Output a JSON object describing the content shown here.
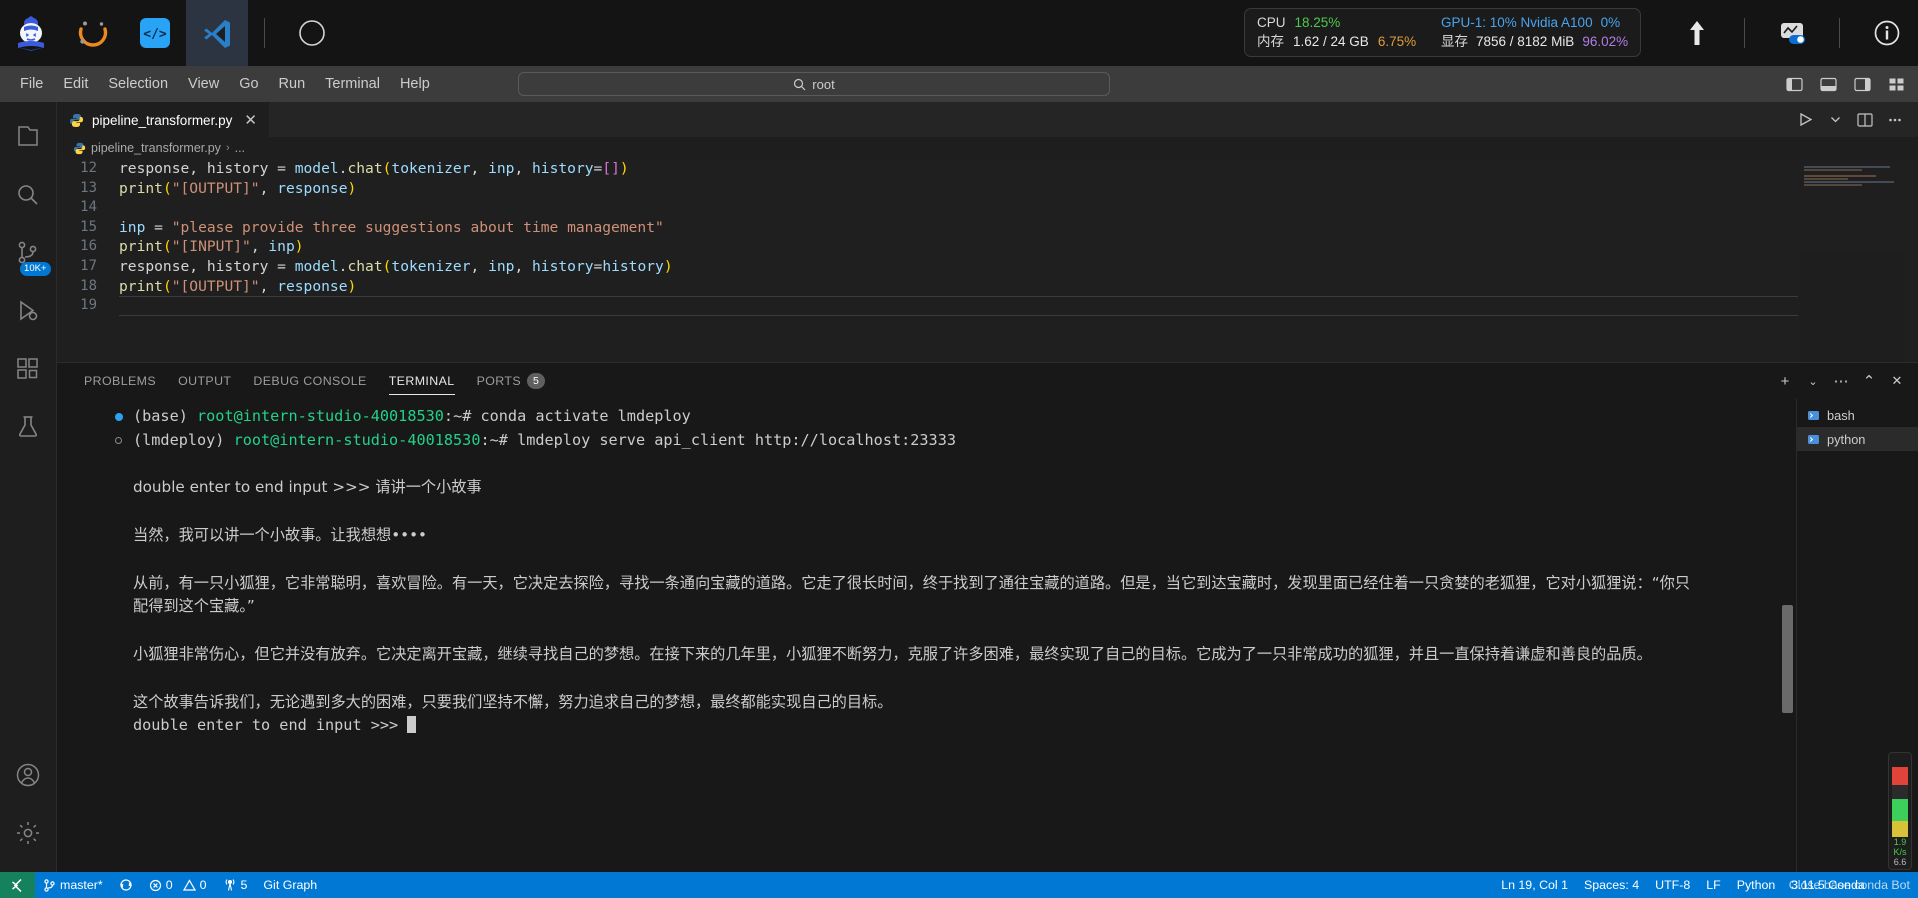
{
  "hostbar": {
    "launcher_items": [
      {
        "name": "intern-studio-logo-icon",
        "label": "InternStudio"
      },
      {
        "name": "conda-icon",
        "label": "Conda"
      },
      {
        "name": "code-brackets-icon",
        "label": "Code"
      },
      {
        "name": "vscode-icon",
        "label": "VS Code"
      },
      {
        "name": "compass-icon",
        "label": "Explore"
      }
    ],
    "sysinfo": {
      "cpu_label": "CPU",
      "cpu_value": "18.25%",
      "mem_label": "内存",
      "mem_value": "1.62 / 24 GB",
      "mem_pct": "6.75%",
      "gpu_label": "GPU-1: 10% Nvidia A100",
      "gpu_pct": "0%",
      "vram_label": "显存",
      "vram_value": "7856 / 8182 MiB",
      "vram_pct": "96.02%"
    },
    "right_icons": [
      {
        "name": "upload-arrow-icon"
      },
      {
        "name": "monitor-toggle-icon"
      },
      {
        "name": "info-icon"
      }
    ]
  },
  "titlebar": {
    "menus": [
      "File",
      "Edit",
      "Selection",
      "View",
      "Go",
      "Run",
      "Terminal",
      "Help"
    ],
    "back_arrow": "←",
    "forward_arrow": "→",
    "command_center": {
      "icon": "search-icon",
      "text": "root"
    },
    "layout_icons": [
      {
        "name": "toggle-primary-sidebar-icon"
      },
      {
        "name": "toggle-panel-icon"
      },
      {
        "name": "toggle-secondary-sidebar-icon"
      },
      {
        "name": "customize-layout-icon"
      }
    ]
  },
  "activitybar": {
    "items": [
      {
        "name": "explorer-icon",
        "label": "Explorer",
        "badge": null
      },
      {
        "name": "search-icon",
        "label": "Search",
        "badge": null
      },
      {
        "name": "source-control-icon",
        "label": "Source Control",
        "badge": "10K+"
      },
      {
        "name": "run-and-debug-icon",
        "label": "Run and Debug",
        "badge": null
      },
      {
        "name": "extensions-icon",
        "label": "Extensions",
        "badge": null
      },
      {
        "name": "testing-icon",
        "label": "Testing",
        "badge": null
      }
    ],
    "bottom_items": [
      {
        "name": "accounts-icon",
        "label": "Accounts"
      },
      {
        "name": "settings-gear-icon",
        "label": "Manage"
      }
    ]
  },
  "editor": {
    "tab": {
      "filename": "pipeline_transformer.py",
      "icon": "python-file-icon",
      "close": "✕"
    },
    "tab_actions": [
      {
        "name": "run-python-file-icon"
      },
      {
        "name": "run-chevron-icon"
      },
      {
        "name": "split-editor-icon"
      },
      {
        "name": "more-actions-icon"
      }
    ],
    "breadcrumb": {
      "file": "pipeline_transformer.py",
      "separator": "›",
      "symbol": "..."
    },
    "lines": [
      {
        "num": "12",
        "tokens": [
          {
            "t": "response, history ",
            "c": "t-plain"
          },
          {
            "t": "= ",
            "c": "t-plain"
          },
          {
            "t": "model",
            "c": "t-var"
          },
          {
            "t": ".",
            "c": "t-plain"
          },
          {
            "t": "chat",
            "c": "t-fn"
          },
          {
            "t": "(",
            "c": "t-punc"
          },
          {
            "t": "tokenizer",
            "c": "t-var"
          },
          {
            "t": ", ",
            "c": "t-plain"
          },
          {
            "t": "inp",
            "c": "t-var"
          },
          {
            "t": ", ",
            "c": "t-plain"
          },
          {
            "t": "history",
            "c": "t-var"
          },
          {
            "t": "=",
            "c": "t-plain"
          },
          {
            "t": "[]",
            "c": "t-punc2"
          },
          {
            "t": ")",
            "c": "t-punc"
          }
        ]
      },
      {
        "num": "13",
        "tokens": [
          {
            "t": "print",
            "c": "t-fn"
          },
          {
            "t": "(",
            "c": "t-punc"
          },
          {
            "t": "\"[OUTPUT]\"",
            "c": "t-str"
          },
          {
            "t": ", ",
            "c": "t-plain"
          },
          {
            "t": "response",
            "c": "t-var"
          },
          {
            "t": ")",
            "c": "t-punc"
          }
        ]
      },
      {
        "num": "14",
        "tokens": []
      },
      {
        "num": "15",
        "tokens": [
          {
            "t": "inp ",
            "c": "t-var"
          },
          {
            "t": "= ",
            "c": "t-plain"
          },
          {
            "t": "\"please provide three suggestions about time management\"",
            "c": "t-str"
          }
        ]
      },
      {
        "num": "16",
        "tokens": [
          {
            "t": "print",
            "c": "t-fn"
          },
          {
            "t": "(",
            "c": "t-punc"
          },
          {
            "t": "\"[INPUT]\"",
            "c": "t-str"
          },
          {
            "t": ", ",
            "c": "t-plain"
          },
          {
            "t": "inp",
            "c": "t-var"
          },
          {
            "t": ")",
            "c": "t-punc"
          }
        ]
      },
      {
        "num": "17",
        "tokens": [
          {
            "t": "response, history ",
            "c": "t-plain"
          },
          {
            "t": "= ",
            "c": "t-plain"
          },
          {
            "t": "model",
            "c": "t-var"
          },
          {
            "t": ".",
            "c": "t-plain"
          },
          {
            "t": "chat",
            "c": "t-fn"
          },
          {
            "t": "(",
            "c": "t-punc"
          },
          {
            "t": "tokenizer",
            "c": "t-var"
          },
          {
            "t": ", ",
            "c": "t-plain"
          },
          {
            "t": "inp",
            "c": "t-var"
          },
          {
            "t": ", ",
            "c": "t-plain"
          },
          {
            "t": "history",
            "c": "t-var"
          },
          {
            "t": "=",
            "c": "t-plain"
          },
          {
            "t": "history",
            "c": "t-var"
          },
          {
            "t": ")",
            "c": "t-punc"
          }
        ]
      },
      {
        "num": "18",
        "tokens": [
          {
            "t": "print",
            "c": "t-fn"
          },
          {
            "t": "(",
            "c": "t-punc"
          },
          {
            "t": "\"[OUTPUT]\"",
            "c": "t-str"
          },
          {
            "t": ", ",
            "c": "t-plain"
          },
          {
            "t": "response",
            "c": "t-var"
          },
          {
            "t": ")",
            "c": "t-punc"
          }
        ]
      },
      {
        "num": "19",
        "tokens": []
      }
    ]
  },
  "panel": {
    "tabs": [
      {
        "label": "PROBLEMS",
        "active": false,
        "badge": null
      },
      {
        "label": "OUTPUT",
        "active": false,
        "badge": null
      },
      {
        "label": "DEBUG CONSOLE",
        "active": false,
        "badge": null
      },
      {
        "label": "TERMINAL",
        "active": true,
        "badge": null
      },
      {
        "label": "PORTS",
        "active": false,
        "badge": "5"
      }
    ],
    "actions": [
      {
        "name": "new-terminal-icon",
        "glyph": "+"
      },
      {
        "name": "terminal-dropdown-icon",
        "glyph": "⌄"
      },
      {
        "name": "panel-more-actions-icon",
        "glyph": "⋯"
      },
      {
        "name": "maximize-panel-icon",
        "glyph": "⌃"
      },
      {
        "name": "close-panel-icon",
        "glyph": "✕"
      }
    ],
    "terminal_list": [
      {
        "label": "bash",
        "icon": "terminal-bash-icon",
        "active": false
      },
      {
        "label": "python",
        "icon": "terminal-python-icon",
        "active": true
      }
    ],
    "terminal_lines": [
      {
        "type": "command",
        "marker": "filled",
        "segments": [
          {
            "t": "(base) ",
            "c": "t-gray"
          },
          {
            "t": "root@intern-studio-40018530",
            "c": "t-green"
          },
          {
            "t": ":",
            "c": "t-gray"
          },
          {
            "t": "~",
            "c": "t-gray"
          },
          {
            "t": "# conda activate lmdeploy",
            "c": "t-gray"
          }
        ]
      },
      {
        "type": "command",
        "marker": "hollow",
        "segments": [
          {
            "t": "(lmdeploy) ",
            "c": "t-gray"
          },
          {
            "t": "root@intern-studio-40018530",
            "c": "t-green"
          },
          {
            "t": ":",
            "c": "t-gray"
          },
          {
            "t": "~",
            "c": "t-gray"
          },
          {
            "t": "# lmdeploy serve api_client http://localhost:23333",
            "c": "t-gray"
          }
        ]
      },
      {
        "type": "blank",
        "text": ""
      },
      {
        "type": "output",
        "text": "double enter to end input >>> 请讲一个小故事"
      },
      {
        "type": "blank",
        "text": ""
      },
      {
        "type": "output",
        "text": "当然，我可以讲一个小故事。让我想想••••"
      },
      {
        "type": "blank",
        "text": ""
      },
      {
        "type": "output-wrap",
        "text": "从前，有一只小狐狸，它非常聪明，喜欢冒险。有一天，它决定去探险，寻找一条通向宝藏的道路。它走了很长时间，终于找到了通往宝藏的道路。但是，当它到达宝藏时，发现里面已经住着一只贪婪的老狐狸，它对小狐狸说：“你只配得到这个宝藏。”"
      },
      {
        "type": "blank",
        "text": ""
      },
      {
        "type": "output-wrap",
        "text": "小狐狸非常伤心，但它并没有放弃。它决定离开宝藏，继续寻找自己的梦想。在接下来的几年里，小狐狸不断努力，克服了许多困难，最终实现了自己的目标。它成为了一只非常成功的狐狸，并且一直保持着谦虚和善良的品质。"
      },
      {
        "type": "blank",
        "text": ""
      },
      {
        "type": "output",
        "text": "这个故事告诉我们，无论遇到多大的困难，只要我们坚持不懈，努力追求自己的梦想，最终都能实现自己的目标。"
      },
      {
        "type": "prompt",
        "text": "double enter to end input >>> "
      }
    ]
  },
  "statusbar": {
    "left": [
      {
        "name": "remote-indicator",
        "label": "",
        "icon": "remote-connect-icon"
      },
      {
        "name": "branch",
        "label": "master*",
        "icon": "source-control-branch-icon"
      },
      {
        "name": "sync",
        "label": "",
        "icon": "sync-changes-icon"
      },
      {
        "name": "errors",
        "label": "0",
        "icon": "error-icon"
      },
      {
        "name": "warnings",
        "label": "0",
        "icon": "warning-icon"
      },
      {
        "name": "ports",
        "label": "5",
        "icon": "ports-radio-tower-icon"
      },
      {
        "name": "git-graph",
        "label": "Git Graph",
        "icon": null
      }
    ],
    "right": [
      {
        "name": "cursor-position",
        "label": "Ln 19, Col 1"
      },
      {
        "name": "indentation",
        "label": "Spaces: 4"
      },
      {
        "name": "encoding",
        "label": "UTF-8"
      },
      {
        "name": "eol",
        "label": "LF"
      },
      {
        "name": "language-mode",
        "label": "Python"
      },
      {
        "name": "python-interpreter",
        "label": "3.11.5 Conda"
      },
      {
        "name": "conda-env",
        "label": "Close base conda Bot"
      }
    ]
  },
  "net_widget": {
    "speed": "1.9",
    "unit": "K/s",
    "secondary": "6.6"
  }
}
